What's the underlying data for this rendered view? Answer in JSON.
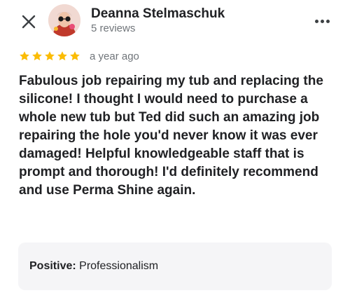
{
  "reviewer": {
    "name": "Deanna Stelmaschuk",
    "review_count": "5 reviews"
  },
  "rating": {
    "stars": 5,
    "max_stars": 5,
    "date": "a year ago",
    "star_color": "#fbbc04"
  },
  "review": {
    "text": "Fabulous job repairing my tub and replacing the silicone! I thought I would need to purchase a whole new tub but Ted did such an amazing job repairing the hole you'd never know it was ever damaged! Helpful knowledgeable staff that is prompt and thorough! I'd definitely recommend and use Perma Shine again."
  },
  "attributes": {
    "label": "Positive:",
    "value": "Professionalism"
  },
  "icons": {
    "close": "close-icon",
    "more": "more-vertical-icon",
    "star": "star-icon"
  }
}
